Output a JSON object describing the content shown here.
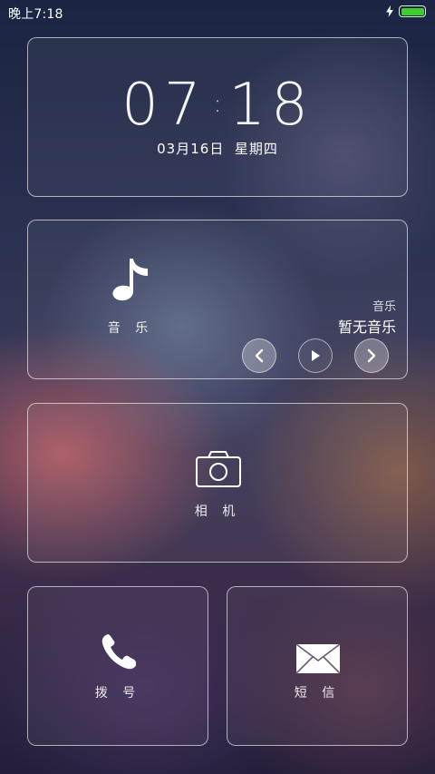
{
  "status_bar": {
    "time": "晚上7:18",
    "charging_icon": "lightning-icon",
    "battery_icon": "battery-icon",
    "battery_level": 1.0,
    "battery_color": "#3ccf2e"
  },
  "clock": {
    "hours": "07",
    "separator": ":",
    "minutes": "18",
    "date": "03月16日  星期四"
  },
  "music": {
    "icon": "music-note-icon",
    "label": "音 乐",
    "app_name": "音乐",
    "track": "暂无音乐",
    "controls": [
      "previous-icon",
      "play-icon",
      "next-icon"
    ]
  },
  "camera": {
    "icon": "camera-icon",
    "label": "相 机"
  },
  "dialer": {
    "icon": "phone-icon",
    "label": "拨 号"
  },
  "sms": {
    "icon": "envelope-icon",
    "label": "短 信"
  }
}
